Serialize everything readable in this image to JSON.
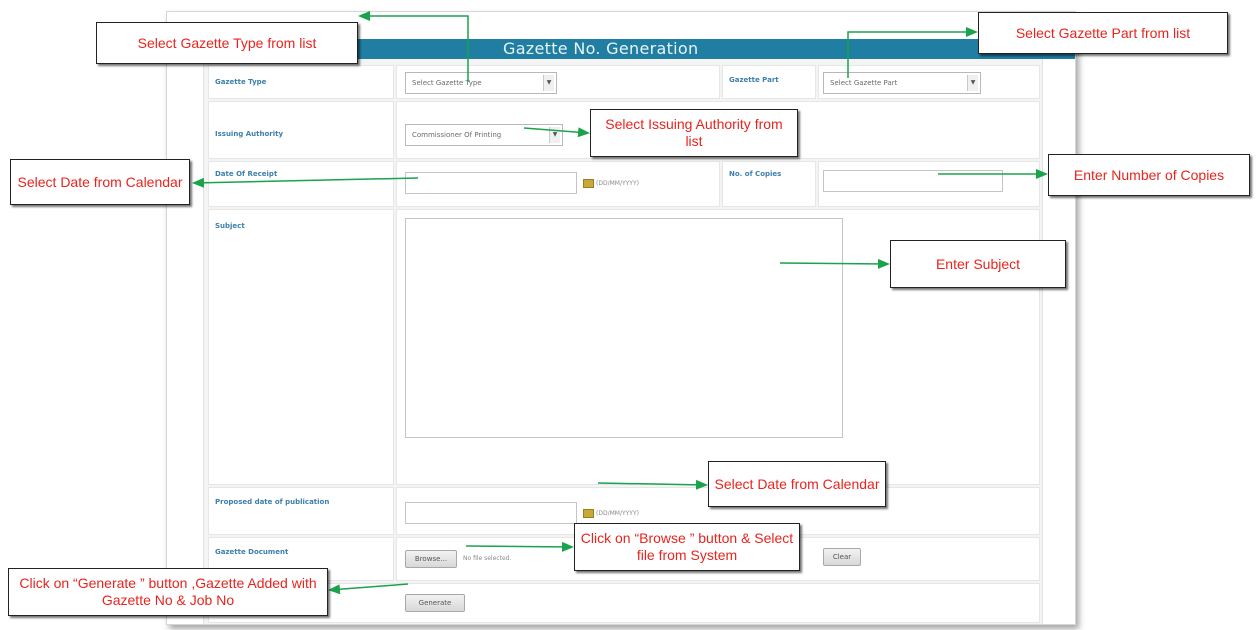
{
  "colors": {
    "header_bg": "#1f7ea2",
    "label_text": "#3c7fae",
    "callout_text": "#e8241e",
    "arrow": "#1aa34a"
  },
  "form": {
    "title": "Gazette No. Generation",
    "gazette_type": {
      "label": "Gazette Type",
      "selected": "Select Gazette Type"
    },
    "gazette_part": {
      "label": "Gazette Part",
      "selected": "Select Gazette Part"
    },
    "issuing_authority": {
      "label": "Issuing Authority",
      "selected": "Commissioner Of Printing"
    },
    "date_of_receipt": {
      "label": "Date Of Receipt",
      "value": "",
      "format": "(DD/MM/YYYY)"
    },
    "no_of_copies": {
      "label": "No. of Copies",
      "value": ""
    },
    "subject": {
      "label": "Subject",
      "value": ""
    },
    "proposed_date": {
      "label": "Proposed date of publication",
      "value": "",
      "format": "(DD/MM/YYYY)"
    },
    "gazette_document": {
      "label": "Gazette Document",
      "browse_label": "Browse...",
      "file_status": "No file selected.",
      "clear_label": "Clear"
    },
    "generate_label": "Generate",
    "calendar_icon": "calendar-icon",
    "dropdown_icon": "chevron-down-icon"
  },
  "callouts": {
    "gazette_type": "Select Gazette Type from list",
    "gazette_part": "Select Gazette Part from list",
    "issuing_authority": "Select Issuing Authority from list",
    "date_receipt": "Select Date from Calendar",
    "copies": "Enter Number of Copies",
    "subject": "Enter Subject",
    "date_publication": "Select Date from Calendar",
    "browse": "Click on “Browse ” button & Select file from System",
    "generate": "Click on “Generate ” button ,Gazette Added with Gazette No & Job No"
  }
}
